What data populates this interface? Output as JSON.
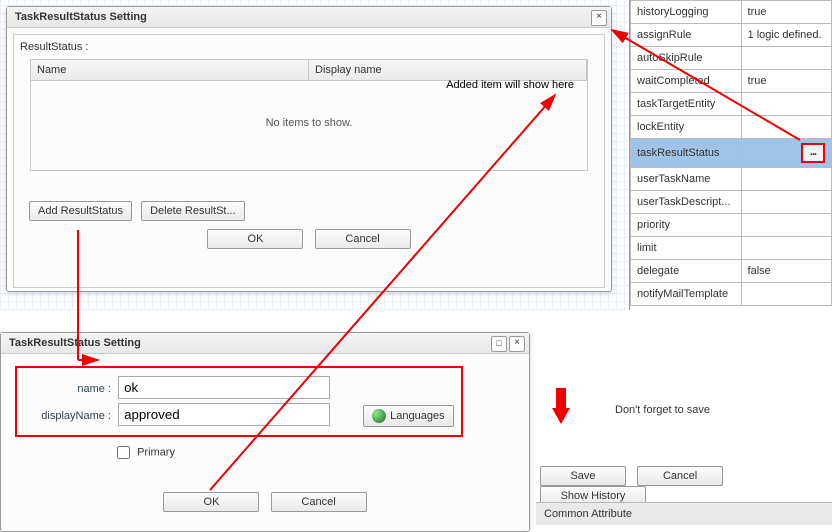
{
  "properties": [
    {
      "key": "historyLogging",
      "val": "true"
    },
    {
      "key": "assignRule",
      "val": "1 logic defined."
    },
    {
      "key": "autoSkipRule",
      "val": ""
    },
    {
      "key": "waitCompleted",
      "val": "true"
    },
    {
      "key": "taskTargetEntity",
      "val": ""
    },
    {
      "key": "lockEntity",
      "val": ""
    },
    {
      "key": "taskResultStatus",
      "val": ""
    },
    {
      "key": "userTaskName",
      "val": ""
    },
    {
      "key": "userTaskDescript...",
      "val": ""
    },
    {
      "key": "priority",
      "val": ""
    },
    {
      "key": "limit",
      "val": ""
    },
    {
      "key": "delegate",
      "val": "false"
    },
    {
      "key": "notifyMailTemplate",
      "val": ""
    }
  ],
  "ellipsis": "...",
  "dialog1": {
    "title": "TaskResultStatus Setting",
    "section_label": "ResultStatus :",
    "col_name": "Name",
    "col_display": "Display name",
    "empty": "No items to show.",
    "hint": "Added item will show here",
    "add": "Add ResultStatus",
    "del": "Delete ResultSt...",
    "ok": "OK",
    "cancel": "Cancel"
  },
  "dialog2": {
    "title": "TaskResultStatus Setting",
    "name_label": "name :",
    "name_value": "ok",
    "disp_label": "displayName :",
    "disp_value": "approved",
    "lang": "Languages",
    "primary": "Primary",
    "ok": "OK",
    "cancel": "Cancel"
  },
  "saveNote": "Don't forget to save",
  "save": "Save",
  "cancel": "Cancel",
  "history": "Show History",
  "commonAttr": "Common Attribute"
}
